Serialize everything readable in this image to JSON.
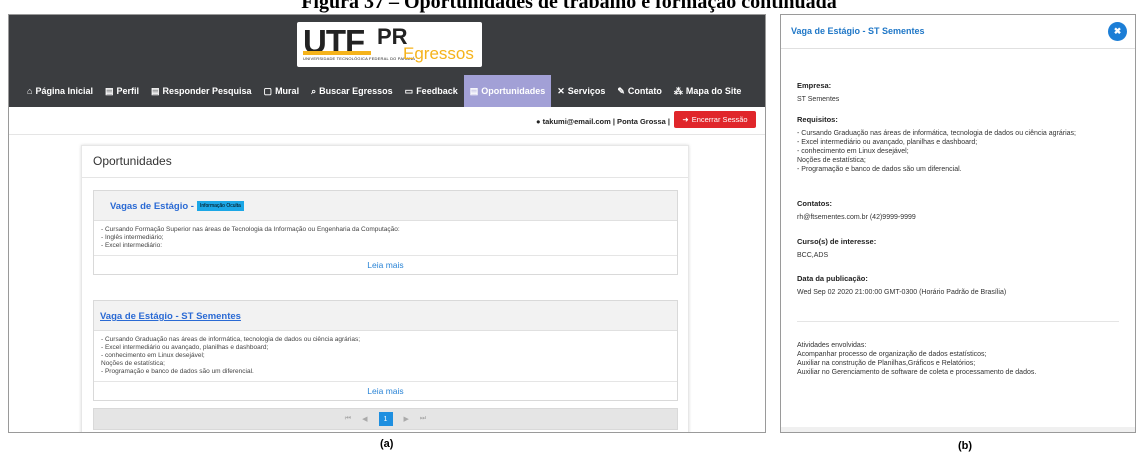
{
  "caption": "Figura 37 – Oportunidades de trabalho e formação continuada",
  "panel_labels": {
    "a": "(a)",
    "b": "(b)"
  },
  "logo": {
    "ut": "UT",
    "f": "F",
    "pr": "PR",
    "egressos": "Egressos",
    "subtitle": "UNIVERSIDADE TECNOLÓGICA FEDERAL DO PARANÁ"
  },
  "nav": [
    {
      "icon": "home-icon",
      "glyph": "⌂",
      "label": "Página Inicial"
    },
    {
      "icon": "id-card-icon",
      "glyph": "▤",
      "label": "Perfil"
    },
    {
      "icon": "id-card-icon",
      "glyph": "▤",
      "label": "Responder Pesquisa"
    },
    {
      "icon": "clipboard-icon",
      "glyph": "▢",
      "label": "Mural"
    },
    {
      "icon": "search-icon",
      "glyph": "⌕",
      "label": "Buscar Egressos"
    },
    {
      "icon": "comment-icon",
      "glyph": "▭",
      "label": "Feedback"
    },
    {
      "icon": "newspaper-icon",
      "glyph": "▤",
      "label": "Oportunidades",
      "active": true
    },
    {
      "icon": "tools-icon",
      "glyph": "✕",
      "label": "Serviços"
    },
    {
      "icon": "edit-icon",
      "glyph": "✎",
      "label": "Contato"
    },
    {
      "icon": "sitemap-icon",
      "glyph": "⁂",
      "label": "Mapa do Site"
    }
  ],
  "user": {
    "info": "takumi@email.com | Ponta Grossa |",
    "logout": "Encerrar Sessão"
  },
  "page_title": "Oportunidades",
  "jobs": [
    {
      "title": "Vagas de Estágio -",
      "badge": "Informação Oculta",
      "lines": [
        "- Cursando Formação Superior nas áreas de Tecnologia da Informação ou Engenharia da Computação:",
        "- Inglês intermediário;",
        "- Excel intermediário:"
      ],
      "more": "Leia mais"
    },
    {
      "title": "Vaga de Estágio - ST Sementes",
      "lines": [
        "- Cursando Graduação nas áreas de informática, tecnologia de dados ou ciência agrárias;",
        "- Excel intermediário ou avançado, planilhas e dashboard;",
        "- conhecimento em Linux desejável;",
        "Noções de estatística;",
        "- Programação e banco de dados são um diferencial."
      ],
      "more": "Leia mais"
    }
  ],
  "pager": {
    "first": "⏮",
    "prev": "◀",
    "current": "1",
    "next": "▶",
    "last": "⏭"
  },
  "modal": {
    "title": "Vaga de Estágio - ST Sementes",
    "close": "✖",
    "empresa_label": "Empresa:",
    "empresa": "ST Sementes",
    "requisitos_label": "Requisitos:",
    "requisitos": [
      "- Cursando Graduação nas áreas de informática, tecnologia de dados ou ciência agrárias;",
      "- Excel intermediário ou avançado, planilhas e dashboard;",
      "- conhecimento em Linux desejável;",
      "Noções de estatística;",
      "- Programação e banco de dados são um diferencial."
    ],
    "contatos_label": "Contatos:",
    "contatos": "rh@ftsementes.com.br (42)9999-9999",
    "cursos_label": "Curso(s) de interesse:",
    "cursos": "BCC,ADS",
    "data_label": "Data da publicação:",
    "data": "Wed Sep 02 2020 21:00:00 GMT-0300 (Horário Padrão de Brasília)",
    "atividades": [
      "Atividades envolvidas:",
      "Acompanhar processo de organização de dados estatísticos;",
      "Auxiliar na construção de Planilhas,Gráficos e Relatórios;",
      "Auxiliar no Gerenciamento de software de coleta e processamento de dados."
    ]
  }
}
